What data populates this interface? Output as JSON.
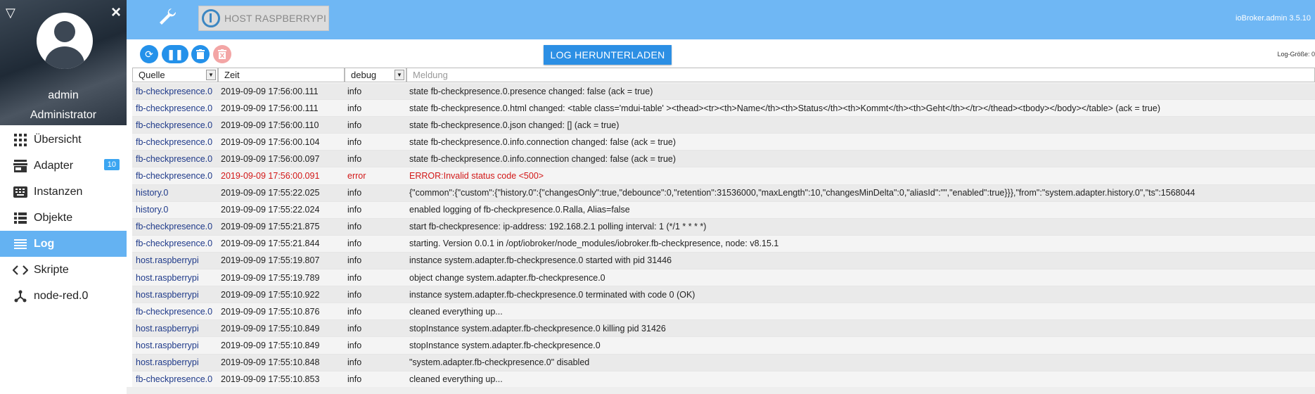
{
  "sidebar": {
    "logo_icon": "triangle-logo-icon",
    "user_name": "admin",
    "user_role": "Administrator",
    "items": [
      {
        "label": "Übersicht",
        "icon": "grid-icon"
      },
      {
        "label": "Adapter",
        "icon": "store-icon",
        "badge": "10"
      },
      {
        "label": "Instanzen",
        "icon": "keyboard-icon"
      },
      {
        "label": "Objekte",
        "icon": "list-icon"
      },
      {
        "label": "Log",
        "icon": "log-list-icon"
      },
      {
        "label": "Skripte",
        "icon": "code-icon"
      },
      {
        "label": "node-red.0",
        "icon": "node-icon"
      }
    ]
  },
  "topbar": {
    "host_label": "HOST RASPBERRYPI",
    "version": "ioBroker.admin 3.5.10"
  },
  "toolbar": {
    "download_label": "LOG HERUNTERLADEN",
    "log_size_label": "Log-Größe: 0"
  },
  "filters": {
    "source": "Quelle",
    "time": "Zeit",
    "level": "debug",
    "message_placeholder": "Meldung"
  },
  "colors": {
    "topbar": "#6fb7f4",
    "accent": "#2491ea",
    "active_nav": "#64b2f2",
    "error": "#d21818"
  },
  "rows": [
    {
      "source": "fb-checkpresence.0",
      "time": "2019-09-09 17:56:00.111",
      "level": "info",
      "message": "state fb-checkpresence.0.presence changed: false (ack = true)"
    },
    {
      "source": "fb-checkpresence.0",
      "time": "2019-09-09 17:56:00.111",
      "level": "info",
      "message": "state fb-checkpresence.0.html changed: <table class='mdui-table' ><thead><tr><th>Name</th><th>Status</th><th>Kommt</th><th>Geht</th></tr></thead><tbody></body></table> (ack = true)"
    },
    {
      "source": "fb-checkpresence.0",
      "time": "2019-09-09 17:56:00.110",
      "level": "info",
      "message": "state fb-checkpresence.0.json changed: [] (ack = true)"
    },
    {
      "source": "fb-checkpresence.0",
      "time": "2019-09-09 17:56:00.104",
      "level": "info",
      "message": "state fb-checkpresence.0.info.connection changed: false (ack = true)"
    },
    {
      "source": "fb-checkpresence.0",
      "time": "2019-09-09 17:56:00.097",
      "level": "info",
      "message": "state fb-checkpresence.0.info.connection changed: false (ack = true)"
    },
    {
      "source": "fb-checkpresence.0",
      "time": "2019-09-09 17:56:00.091",
      "level": "error",
      "message": "ERROR:Invalid status code <500>"
    },
    {
      "source": "history.0",
      "time": "2019-09-09 17:55:22.025",
      "level": "info",
      "message": "{\"common\":{\"custom\":{\"history.0\":{\"changesOnly\":true,\"debounce\":0,\"retention\":31536000,\"maxLength\":10,\"changesMinDelta\":0,\"aliasId\":\"\",\"enabled\":true}}},\"from\":\"system.adapter.history.0\",\"ts\":1568044"
    },
    {
      "source": "history.0",
      "time": "2019-09-09 17:55:22.024",
      "level": "info",
      "message": "enabled logging of fb-checkpresence.0.Ralla, Alias=false"
    },
    {
      "source": "fb-checkpresence.0",
      "time": "2019-09-09 17:55:21.875",
      "level": "info",
      "message": "start fb-checkpresence: ip-address: 192.168.2.1 polling interval: 1 (*/1 * * * *)"
    },
    {
      "source": "fb-checkpresence.0",
      "time": "2019-09-09 17:55:21.844",
      "level": "info",
      "message": "starting. Version 0.0.1 in /opt/iobroker/node_modules/iobroker.fb-checkpresence, node: v8.15.1"
    },
    {
      "source": "host.raspberrypi",
      "time": "2019-09-09 17:55:19.807",
      "level": "info",
      "message": "instance system.adapter.fb-checkpresence.0 started with pid 31446"
    },
    {
      "source": "host.raspberrypi",
      "time": "2019-09-09 17:55:19.789",
      "level": "info",
      "message": "object change system.adapter.fb-checkpresence.0"
    },
    {
      "source": "host.raspberrypi",
      "time": "2019-09-09 17:55:10.922",
      "level": "info",
      "message": "instance system.adapter.fb-checkpresence.0 terminated with code 0 (OK)"
    },
    {
      "source": "fb-checkpresence.0",
      "time": "2019-09-09 17:55:10.876",
      "level": "info",
      "message": "cleaned everything up..."
    },
    {
      "source": "host.raspberrypi",
      "time": "2019-09-09 17:55:10.849",
      "level": "info",
      "message": "stopInstance system.adapter.fb-checkpresence.0 killing pid 31426"
    },
    {
      "source": "host.raspberrypi",
      "time": "2019-09-09 17:55:10.849",
      "level": "info",
      "message": "stopInstance system.adapter.fb-checkpresence.0"
    },
    {
      "source": "host.raspberrypi",
      "time": "2019-09-09 17:55:10.848",
      "level": "info",
      "message": "\"system.adapter.fb-checkpresence.0\" disabled"
    },
    {
      "source": "fb-checkpresence.0",
      "time": "2019-09-09 17:55:10.853",
      "level": "info",
      "message": "cleaned everything up..."
    }
  ]
}
